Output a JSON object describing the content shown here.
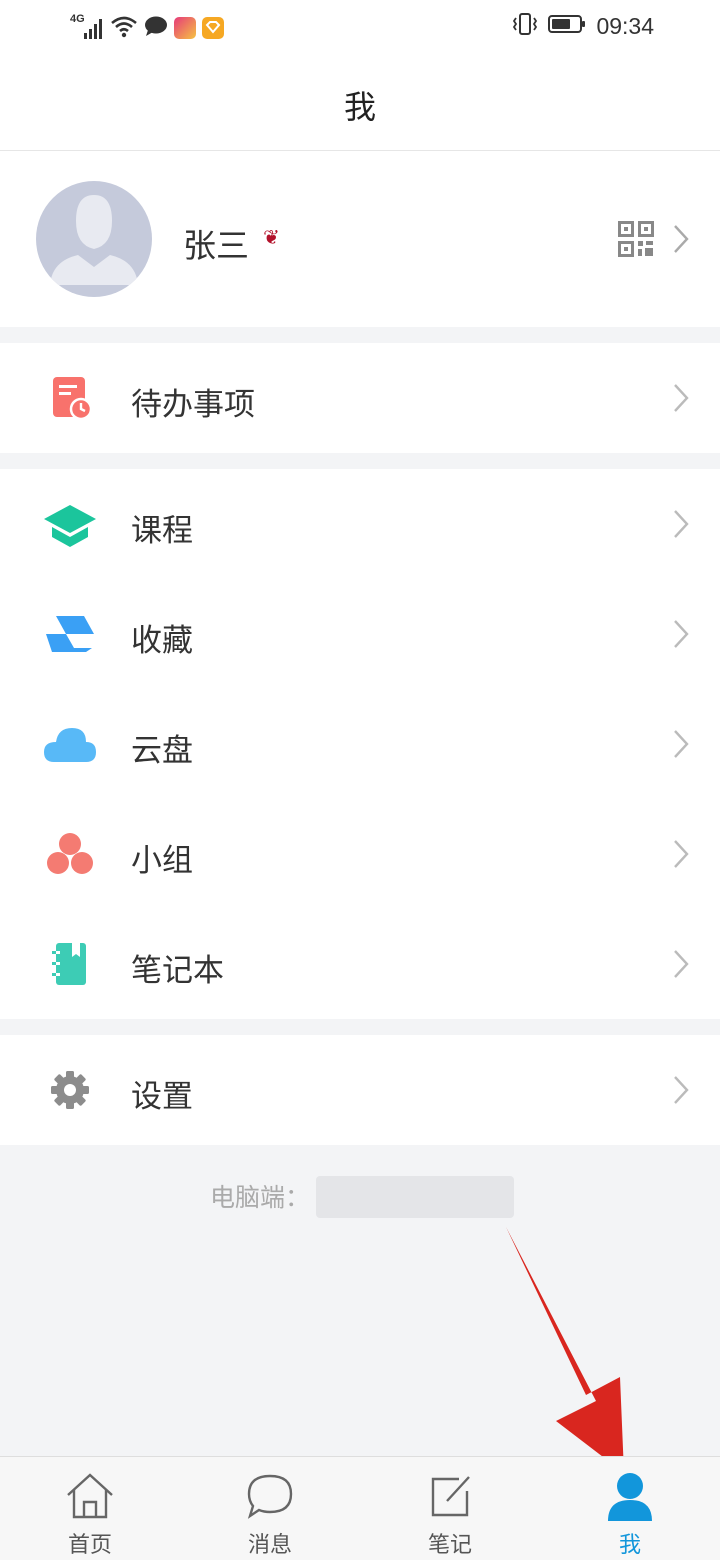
{
  "status_bar": {
    "network": "4G",
    "time": "09:34"
  },
  "nav": {
    "title": "我"
  },
  "profile": {
    "name": "张三"
  },
  "menu": {
    "todo": "待办事项",
    "items": [
      "课程",
      "收藏",
      "云盘",
      "小组",
      "笔记本"
    ],
    "settings": "设置"
  },
  "footer": {
    "pc_label": "电脑端："
  },
  "tabs": [
    "首页",
    "消息",
    "笔记",
    "我"
  ],
  "colors": {
    "accent": "#1296db",
    "todo_icon": "#f8726c",
    "course_icon": "#1bc59c",
    "favorite_icon": "#3aa0f5",
    "cloud_icon": "#58b9f7",
    "group_icon": "#f47b72",
    "notebook_icon": "#3dccb5",
    "settings_icon": "#8c8c8c",
    "annotation_arrow": "#d9261f"
  }
}
